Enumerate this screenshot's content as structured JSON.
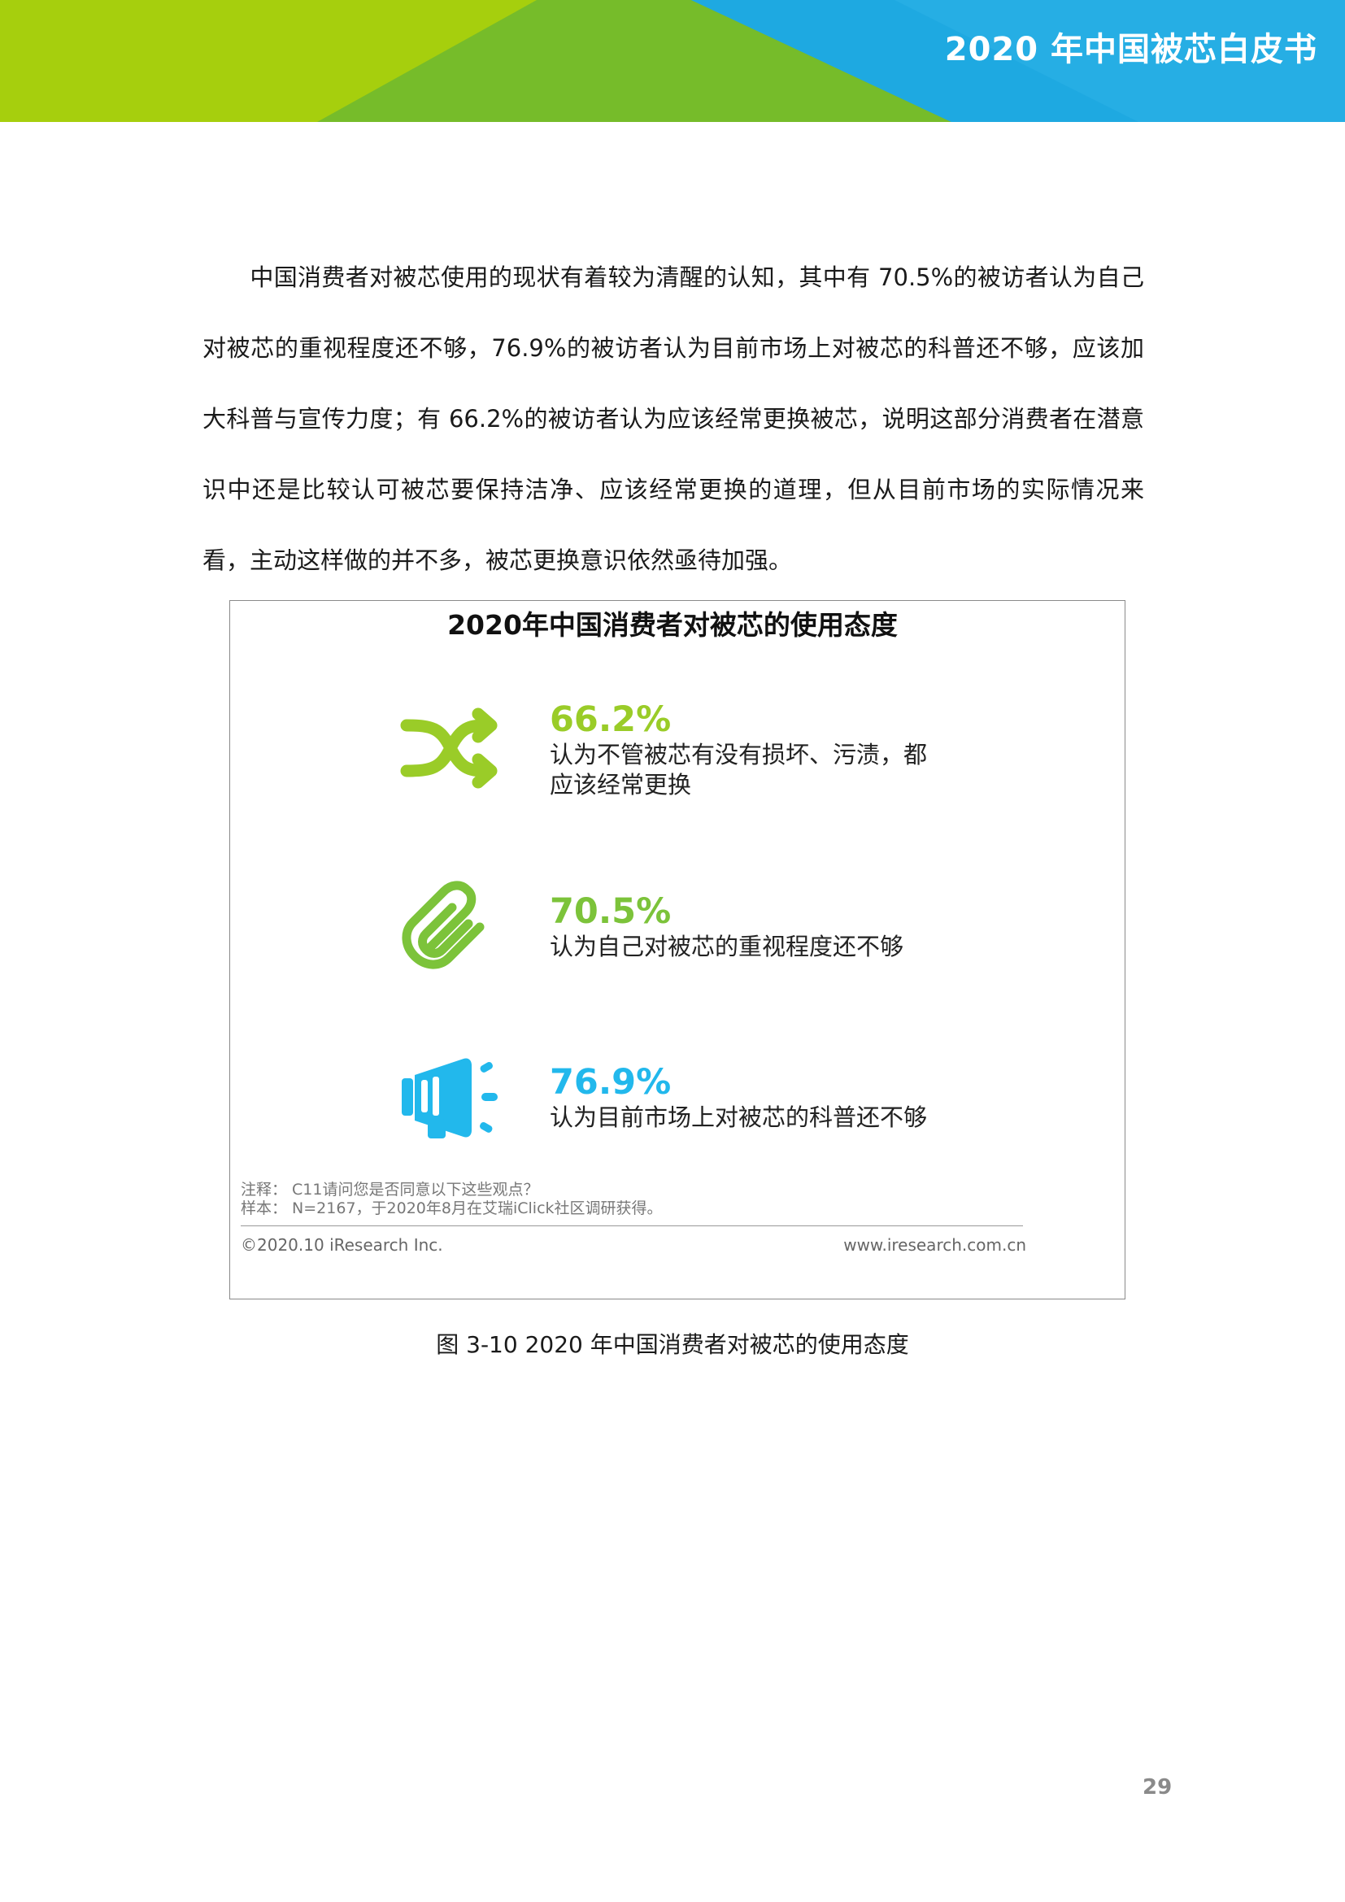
{
  "header": {
    "title": "2020 年中国被芯白皮书",
    "colors": {
      "green_light": "#a6cf0d",
      "green": "#76bc2a",
      "blue": "#19a8e0"
    }
  },
  "body_text": "中国消费者对被芯使用的现状有着较为清醒的认知，其中有 70.5%的被访者认为自己对被芯的重视程度还不够，76.9%的被访者认为目前市场上对被芯的科普还不够，应该加大科普与宣传力度；有 66.2%的被访者认为应该经常更换被芯，说明这部分消费者在潜意识中还是比较认可被芯要保持洁净、应该经常更换的道理，但从目前市场的实际情况来看，主动这样做的并不多，被芯更换意识依然亟待加强。",
  "figure": {
    "title": "2020年中国消费者对被芯的使用态度",
    "stats": [
      {
        "value": "66.2%",
        "desc_line1": "认为不管被芯有没有损坏、污渍，都",
        "desc_line2": "应该经常更换",
        "color": "#9acc28",
        "icon": "shuffle-icon"
      },
      {
        "value": "70.5%",
        "desc_line1": "认为自己对被芯的重视程度还不够",
        "color": "#7cc33a",
        "icon": "paperclip-icon"
      },
      {
        "value": "76.9%",
        "desc_line1": "认为目前市场上对被芯的科普还不够",
        "color": "#22b8ec",
        "icon": "megaphone-icon"
      }
    ],
    "note": "注释： C11请问您是否同意以下这些观点？",
    "sample": "样本： N=2167，于2020年8月在艾瑞iClick社区调研获得。",
    "copyright": "©2020.10 iResearch Inc.",
    "website": "www.iresearch.com.cn"
  },
  "caption": "图 3-10 2020 年中国消费者对被芯的使用态度",
  "page_number": "29"
}
